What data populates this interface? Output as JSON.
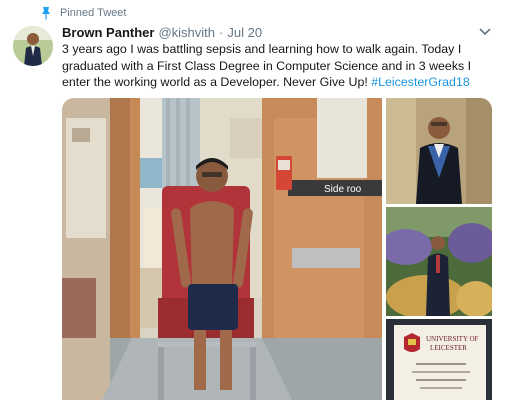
{
  "pinned": {
    "label": "Pinned Tweet",
    "icon": "pin-icon"
  },
  "author": {
    "name": "Brown Panther",
    "handle": "@kishvith",
    "separator": "·",
    "date": "Jul 20"
  },
  "tweet": {
    "text": "3 years ago I was battling sepsis and learning how to walk again. Today I graduated with a First Class Degree in Computer Science and in 3 weeks I enter the working world as a Developer. Never Give Up! ",
    "hashtag": "#LeicesterGrad18"
  },
  "photos": {
    "hospital": {
      "sign_text": "Side roo"
    },
    "certificate": {
      "university": "UNIVERSITY OF",
      "city": "LEICESTER"
    }
  },
  "colors": {
    "link": "#1b95e0",
    "secondary_text": "#657786",
    "primary_text": "#14171a"
  }
}
